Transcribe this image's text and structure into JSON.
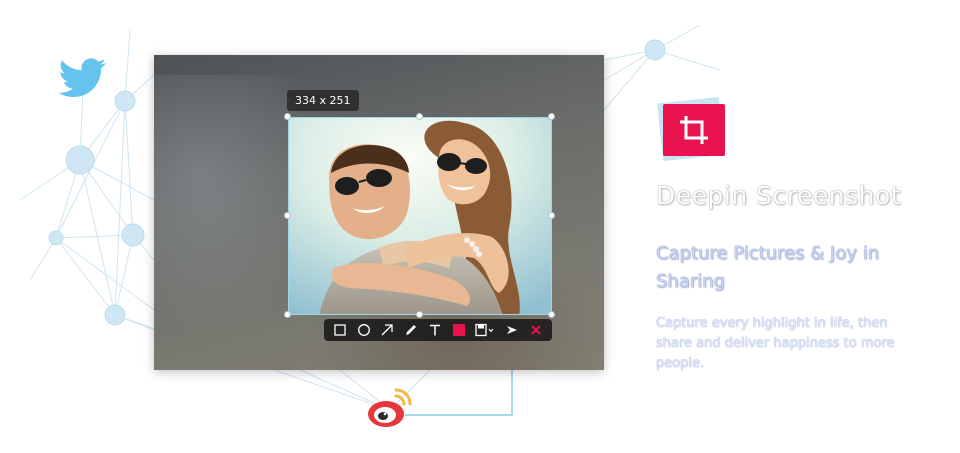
{
  "selection": {
    "size_label": "334 x 251"
  },
  "toolbar": {
    "tools": [
      {
        "id": "rect",
        "icon": "rectangle-icon"
      },
      {
        "id": "ellipse",
        "icon": "ellipse-icon"
      },
      {
        "id": "arrow",
        "icon": "arrow-icon"
      },
      {
        "id": "pen",
        "icon": "pencil-icon"
      },
      {
        "id": "text",
        "icon": "text-icon"
      },
      {
        "id": "color",
        "icon": "color-swatch",
        "color": "#e8124f"
      },
      {
        "id": "save",
        "icon": "save-icon"
      },
      {
        "id": "share",
        "icon": "share-icon"
      },
      {
        "id": "close",
        "icon": "close-icon",
        "color": "#e8124f"
      }
    ]
  },
  "product": {
    "title": "Deepin Screenshot",
    "headline": "Capture Pictures & Joy in Sharing",
    "description": "Capture every highlight in life, then share and deliver happiness to more people."
  },
  "social": {
    "twitter_icon": "twitter-bird-icon",
    "weibo_icon": "weibo-icon"
  },
  "colors": {
    "accent": "#e8124f",
    "network": "#c7e3f1",
    "subtitle": "#c9d4f2"
  }
}
